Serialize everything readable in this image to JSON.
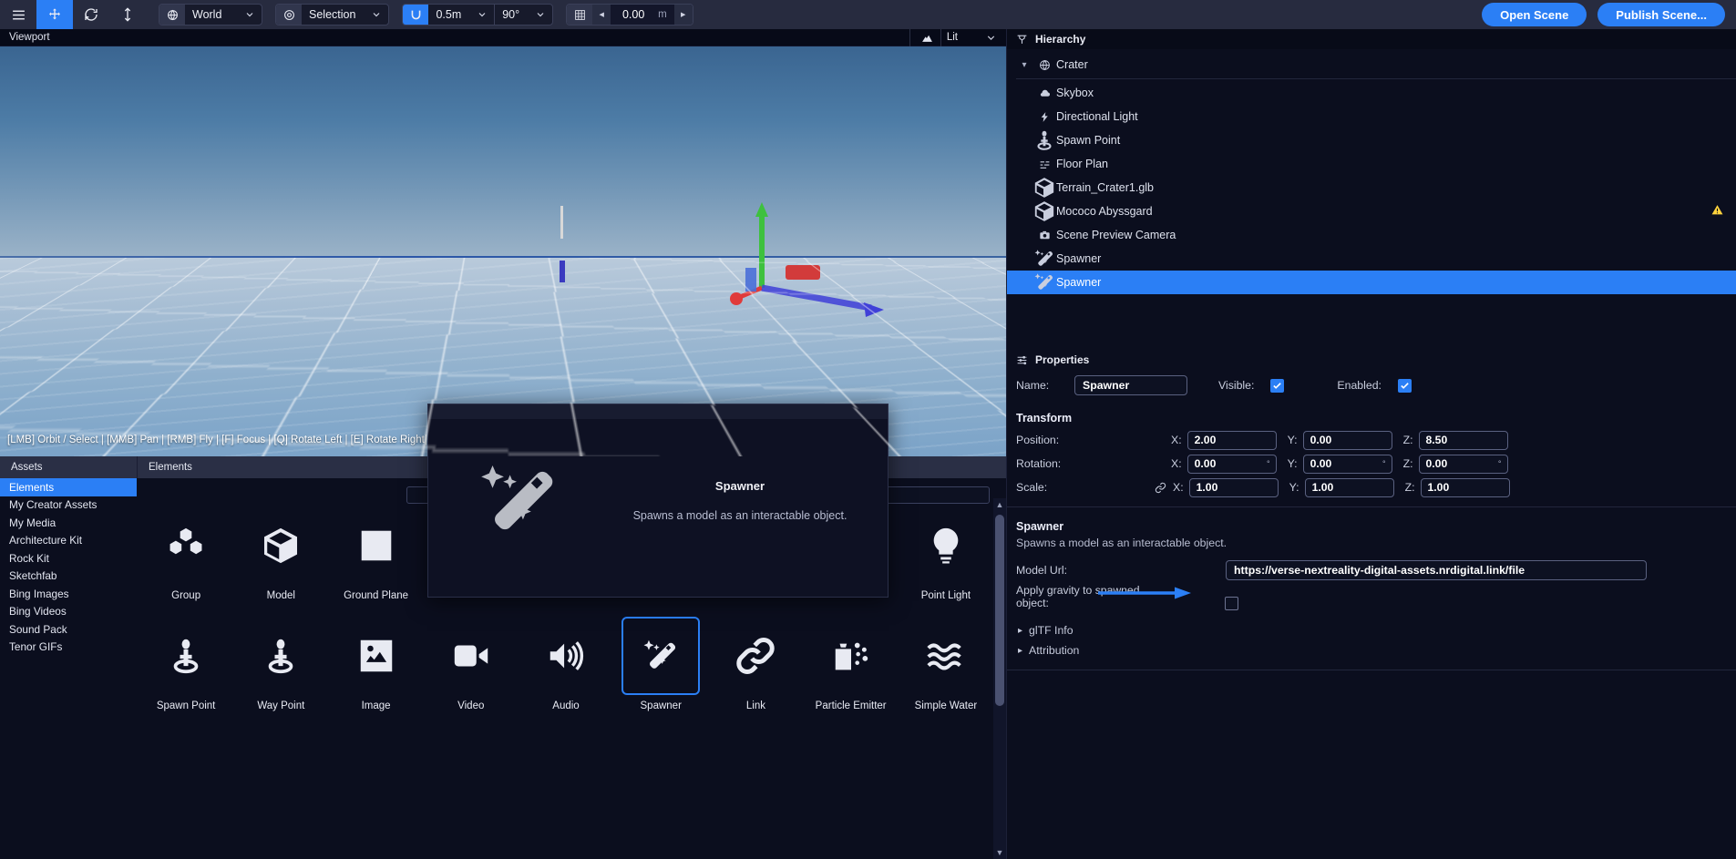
{
  "toolbar": {
    "menu_icon": "hamburger-icon",
    "tools": [
      {
        "name": "move-tool",
        "icon": "move-arrows-icon",
        "active": true
      },
      {
        "name": "rotate-tool",
        "icon": "rotate-icon",
        "active": false
      },
      {
        "name": "scale-tool",
        "icon": "scale-vertical-icon",
        "active": false
      }
    ],
    "coord_space": {
      "icon": "globe-icon",
      "value": "World"
    },
    "pivot": {
      "icon": "target-icon",
      "value": "Selection"
    },
    "snap_translate": {
      "icon": "magnet-icon",
      "value": "0.5m"
    },
    "snap_rotate": {
      "value": "90°"
    },
    "grid": {
      "icon": "grid-icon",
      "value": "0.00",
      "unit": "m",
      "left_arrow": "◀",
      "right_arrow": "▶"
    },
    "open_scene_label": "Open Scene",
    "publish_scene_label": "Publish Scene..."
  },
  "viewport": {
    "title": "Viewport",
    "shading_icon": "chart-mountain-icon",
    "shading_mode": "Lit",
    "hint": "[LMB] Orbit / Select | [MMB] Pan | [RMB] Fly | [F] Focus | [Q] Rotate Left | [E] Rotate Right| [G] G"
  },
  "tooltip": {
    "icon": "magic-wand-icon",
    "title": "Spawner",
    "description": "Spawns a model as an interactable object."
  },
  "assets": {
    "sidebar_header": "Assets",
    "main_header": "Elements",
    "search_value": "",
    "categories": [
      {
        "label": "Elements",
        "active": true
      },
      {
        "label": "My Creator Assets",
        "active": false
      },
      {
        "label": "My Media",
        "active": false
      },
      {
        "label": "Architecture Kit",
        "active": false
      },
      {
        "label": "Rock Kit",
        "active": false
      },
      {
        "label": "Sketchfab",
        "active": false
      },
      {
        "label": "Bing Images",
        "active": false
      },
      {
        "label": "Bing Videos",
        "active": false
      },
      {
        "label": "Sound Pack",
        "active": false
      },
      {
        "label": "Tenor GIFs",
        "active": false
      }
    ],
    "items": [
      {
        "label": "Group",
        "icon": "group-cubes-icon",
        "selected": false
      },
      {
        "label": "Model",
        "icon": "cube-icon",
        "selected": false
      },
      {
        "label": "Ground Plane",
        "icon": "square-plane-icon",
        "selected": false
      },
      {
        "label": "",
        "icon": "blank-icon",
        "selected": false
      },
      {
        "label": "",
        "icon": "blank-icon",
        "selected": false
      },
      {
        "label": "",
        "icon": "blank-icon",
        "selected": false
      },
      {
        "label": "",
        "icon": "blank-icon",
        "selected": false
      },
      {
        "label": "",
        "icon": "blank-icon",
        "selected": false
      },
      {
        "label": "Point Light",
        "icon": "lightbulb-icon",
        "selected": false
      },
      {
        "label": "Spawn Point",
        "icon": "spawn-point-icon",
        "selected": false
      },
      {
        "label": "Way Point",
        "icon": "way-point-icon",
        "selected": false
      },
      {
        "label": "Image",
        "icon": "image-icon",
        "selected": false
      },
      {
        "label": "Video",
        "icon": "video-camera-icon",
        "selected": false
      },
      {
        "label": "Audio",
        "icon": "speaker-icon",
        "selected": false
      },
      {
        "label": "Spawner",
        "icon": "magic-wand-icon",
        "selected": true
      },
      {
        "label": "Link",
        "icon": "chain-link-icon",
        "selected": false
      },
      {
        "label": "Particle Emitter",
        "icon": "particle-emitter-icon",
        "selected": false
      },
      {
        "label": "Simple Water",
        "icon": "waves-icon",
        "selected": false
      }
    ]
  },
  "hierarchy": {
    "title": "Hierarchy",
    "panel_icon": "hierarchy-icon",
    "root": {
      "label": "Crater",
      "icon": "globe-icon",
      "expanded": true,
      "caret": "▾"
    },
    "nodes": [
      {
        "label": "Skybox",
        "icon": "cloud-icon",
        "selected": false,
        "warning": false
      },
      {
        "label": "Directional Light",
        "icon": "bolt-icon",
        "selected": false,
        "warning": false
      },
      {
        "label": "Spawn Point",
        "icon": "spawn-point-icon",
        "selected": false,
        "warning": false
      },
      {
        "label": "Floor Plan",
        "icon": "floor-plan-icon",
        "selected": false,
        "warning": false
      },
      {
        "label": "Terrain_Crater1.glb",
        "icon": "cube-icon",
        "selected": false,
        "warning": false
      },
      {
        "label": "Mococo Abyssgard",
        "icon": "cube-icon",
        "selected": false,
        "warning": true
      },
      {
        "label": "Scene Preview Camera",
        "icon": "camera-icon",
        "selected": false,
        "warning": false
      },
      {
        "label": "Spawner",
        "icon": "magic-wand-icon",
        "selected": false,
        "warning": false
      },
      {
        "label": "Spawner",
        "icon": "magic-wand-icon",
        "selected": true,
        "warning": false
      }
    ]
  },
  "properties": {
    "title": "Properties",
    "panel_icon": "sliders-icon",
    "name_label": "Name:",
    "name_value": "Spawner",
    "visible_label": "Visible:",
    "visible_checked": true,
    "enabled_label": "Enabled:",
    "enabled_checked": true,
    "transform_title": "Transform",
    "position_label": "Position:",
    "rotation_label": "Rotation:",
    "scale_label": "Scale:",
    "axis_x": "X:",
    "axis_y": "Y:",
    "axis_z": "Z:",
    "degree_symbol": "°",
    "link_icon": "chain-link-icon",
    "position": {
      "x": "2.00",
      "y": "0.00",
      "z": "8.50"
    },
    "rotation": {
      "x": "0.00",
      "y": "0.00",
      "z": "0.00"
    },
    "scale": {
      "x": "1.00",
      "y": "1.00",
      "z": "1.00"
    },
    "spawner_title": "Spawner",
    "spawner_desc": "Spawns a model as an interactable object.",
    "model_url_label": "Model Url:",
    "model_url_value": "https://verse-nextreality-digital-assets.nrdigital.link/file",
    "gravity_label": "Apply gravity to spawned object:",
    "gravity_checked": false,
    "gltf_info_label": "glTF Info",
    "attribution_label": "Attribution",
    "collapse_caret": "▸"
  },
  "colors": {
    "accent": "#2b7ff5",
    "toolbar_bg": "#272b3f",
    "panel_bg": "#0b0e1e",
    "warning": "#ffd23d"
  }
}
